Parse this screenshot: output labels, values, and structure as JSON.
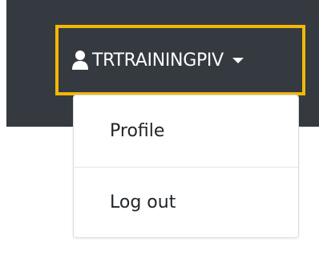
{
  "user_menu": {
    "username": "TRTRAININGPIV",
    "user_icon": "user-icon",
    "caret_icon": "caret-down-icon",
    "highlight_color": "#f2b807",
    "navbar_color": "#343a40"
  },
  "dropdown": {
    "items": [
      {
        "label": "Profile"
      },
      {
        "label": "Log out"
      }
    ]
  }
}
